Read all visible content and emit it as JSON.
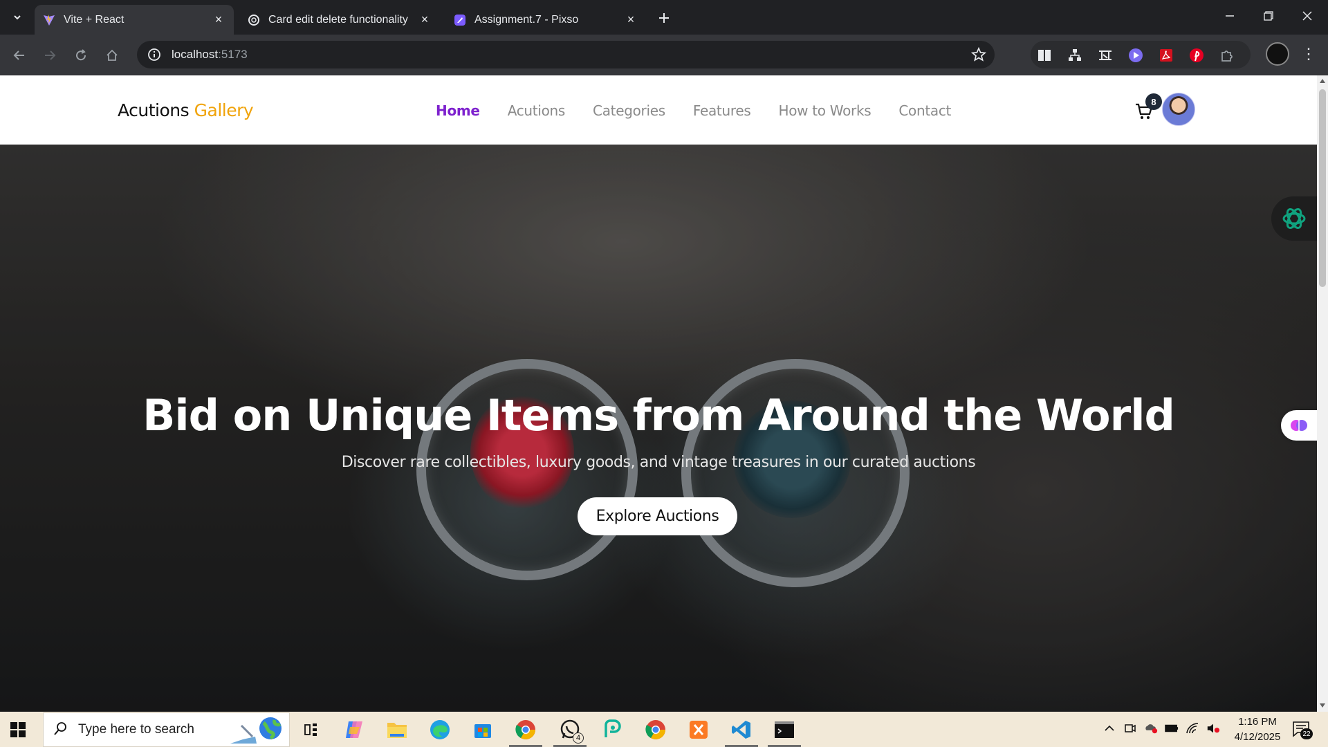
{
  "browser": {
    "tabs": [
      {
        "title": "Vite + React",
        "active": true
      },
      {
        "title": "Card edit delete functionality",
        "active": false
      },
      {
        "title": "Assignment.7 - Pixso",
        "active": false
      }
    ],
    "address": {
      "host": "localhost",
      "port": ":5173"
    }
  },
  "site": {
    "logo_main": "Acutions",
    "logo_accent": "Gallery",
    "nav": [
      {
        "label": "Home",
        "active": true
      },
      {
        "label": "Acutions",
        "active": false
      },
      {
        "label": "Categories",
        "active": false
      },
      {
        "label": "Features",
        "active": false
      },
      {
        "label": "How to Works",
        "active": false
      },
      {
        "label": "Contact",
        "active": false
      }
    ],
    "cart_count": "8",
    "colors": {
      "accent": "#f0a30a",
      "active_link": "#7e22ce"
    }
  },
  "hero": {
    "title": "Bid on Unique Items from Around the World",
    "subtitle": "Discover rare collectibles, luxury goods, and vintage treasures in our curated auctions",
    "button": "Explore Auctions"
  },
  "taskbar": {
    "search_placeholder": "Type here to search",
    "time": "1:16 PM",
    "date": "4/12/2025",
    "whatsapp_badge": "4",
    "notification_count": "22"
  }
}
